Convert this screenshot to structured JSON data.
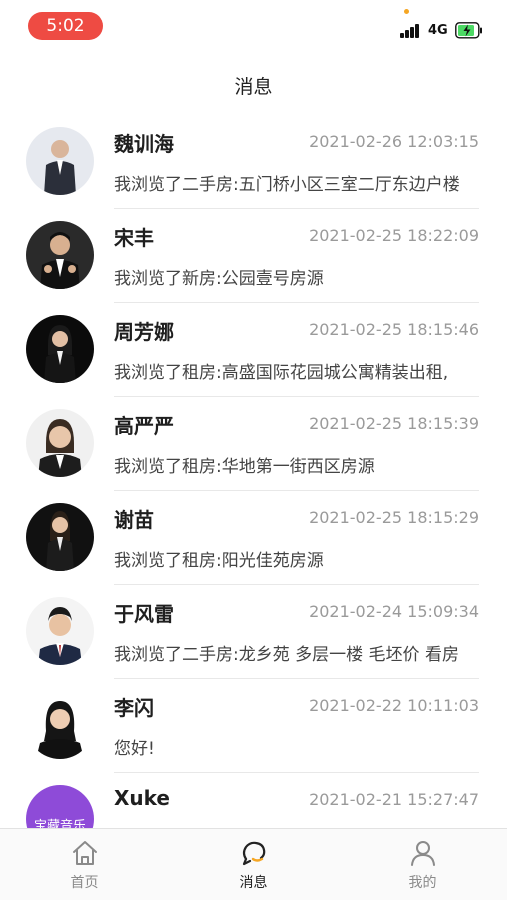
{
  "status_bar": {
    "time": "5:02",
    "network": "4G"
  },
  "header": {
    "title": "消息"
  },
  "messages": [
    {
      "name": "魏训海",
      "time": "2021-02-26 12:03:15",
      "preview": "我浏览了二手房:五门桥小区三室二厅东边户楼"
    },
    {
      "name": "宋丰",
      "time": "2021-02-25 18:22:09",
      "preview": "我浏览了新房:公园壹号房源"
    },
    {
      "name": "周芳娜",
      "time": "2021-02-25 18:15:46",
      "preview": "我浏览了租房:高盛国际花园城公寓精装出租,"
    },
    {
      "name": "高严严",
      "time": "2021-02-25 18:15:39",
      "preview": "我浏览了租房:华地第一街西区房源"
    },
    {
      "name": "谢苗",
      "time": "2021-02-25 18:15:29",
      "preview": "我浏览了租房:阳光佳苑房源"
    },
    {
      "name": "于风雷",
      "time": "2021-02-24 15:09:34",
      "preview": "我浏览了二手房:龙乡苑 多层一楼 毛坯价 看房"
    },
    {
      "name": "李闪",
      "time": "2021-02-22 10:11:03",
      "preview": "您好!"
    },
    {
      "name": "Xuke",
      "time": "2021-02-21 15:27:47",
      "preview": "",
      "avatar_text": "宝藏音乐"
    }
  ],
  "tabs": [
    {
      "label": "首页",
      "icon": "home-icon"
    },
    {
      "label": "消息",
      "icon": "message-icon"
    },
    {
      "label": "我的",
      "icon": "profile-icon"
    }
  ],
  "colors": {
    "time_pill": "#ee4b43",
    "accent": "#f5a623",
    "muted_text": "#9a9a9a",
    "avatar_purple": "#8e4bd8"
  }
}
